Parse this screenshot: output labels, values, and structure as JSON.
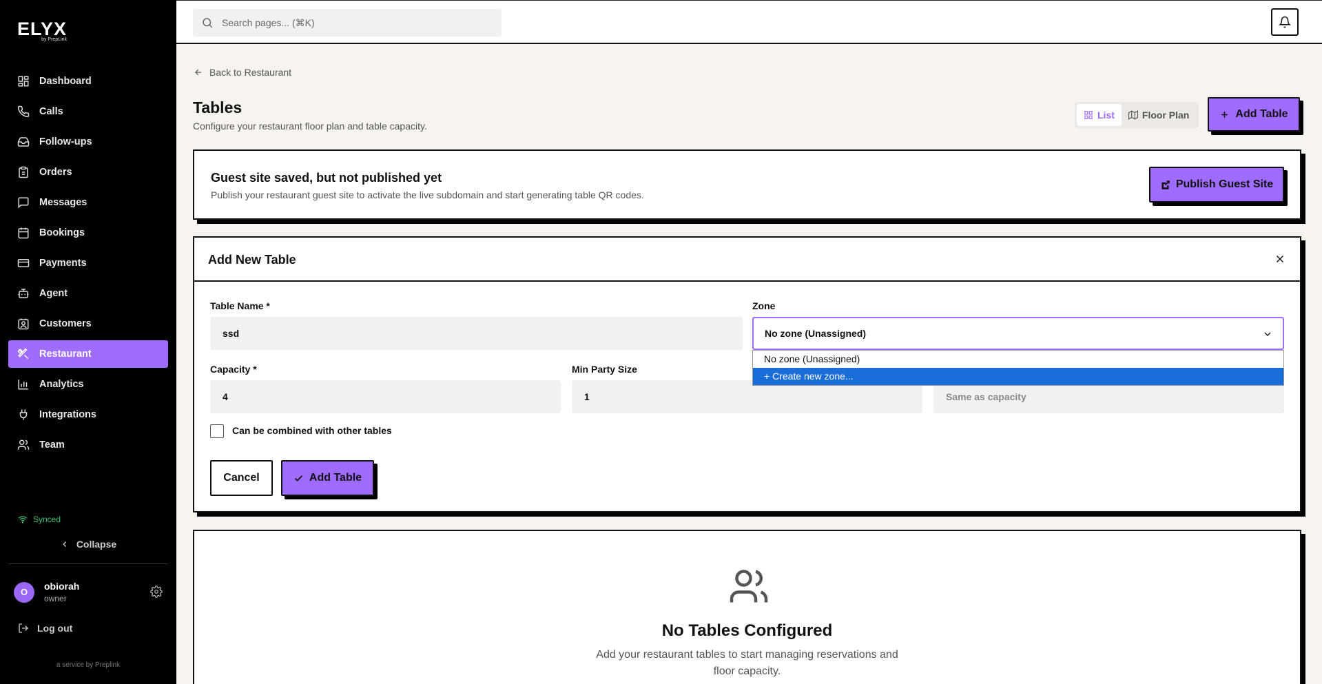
{
  "brand": {
    "name": "ELYX",
    "by": "by PrepLink"
  },
  "sidebar": {
    "items": [
      {
        "label": "Dashboard",
        "icon": "dashboard-icon"
      },
      {
        "label": "Calls",
        "icon": "phone-icon"
      },
      {
        "label": "Follow-ups",
        "icon": "inbox-icon"
      },
      {
        "label": "Orders",
        "icon": "clipboard-icon"
      },
      {
        "label": "Messages",
        "icon": "message-icon"
      },
      {
        "label": "Bookings",
        "icon": "calendar-icon"
      },
      {
        "label": "Payments",
        "icon": "credit-card-icon"
      },
      {
        "label": "Agent",
        "icon": "bot-icon"
      },
      {
        "label": "Customers",
        "icon": "contact-icon"
      },
      {
        "label": "Restaurant",
        "icon": "utensils-icon",
        "active": true
      },
      {
        "label": "Analytics",
        "icon": "bar-chart-icon"
      },
      {
        "label": "Integrations",
        "icon": "plug-icon"
      },
      {
        "label": "Team",
        "icon": "users-icon"
      }
    ],
    "status": "Synced",
    "collapse_label": "Collapse",
    "user": {
      "initial": "O",
      "name": "obiorah",
      "role": "owner"
    },
    "logout_label": "Log out",
    "service_note": "a service by Preplink"
  },
  "topbar": {
    "search_placeholder": "Search pages... (⌘K)"
  },
  "page": {
    "back_label": "Back to Restaurant",
    "title": "Tables",
    "subtitle": "Configure your restaurant floor plan and table capacity.",
    "view_list": "List",
    "view_floor": "Floor Plan",
    "add_table_label": "Add Table"
  },
  "notice": {
    "title": "Guest site saved, but not published yet",
    "text": "Publish your restaurant guest site to activate the live subdomain and start generating table QR codes.",
    "publish_label": "Publish Guest Site"
  },
  "form": {
    "title": "Add New Table",
    "table_name_label": "Table Name *",
    "table_name_value": "ssd",
    "zone_label": "Zone",
    "zone_value": "No zone (Unassigned)",
    "zone_options": [
      "No zone (Unassigned)",
      "+ Create new zone..."
    ],
    "capacity_label": "Capacity *",
    "capacity_value": "4",
    "min_party_label": "Min Party Size",
    "min_party_value": "1",
    "max_party_placeholder": "Same as capacity",
    "combine_label": "Can be combined with other tables",
    "cancel_label": "Cancel",
    "submit_label": "Add Table"
  },
  "empty": {
    "title": "No Tables Configured",
    "text": "Add your restaurant tables to start managing reservations and floor capacity."
  },
  "colors": {
    "accent": "#a06bff",
    "sidebar_bg": "#000000",
    "page_bg": "#f7f3ee",
    "selected_option": "#1a6cd6",
    "synced": "#38c172"
  }
}
